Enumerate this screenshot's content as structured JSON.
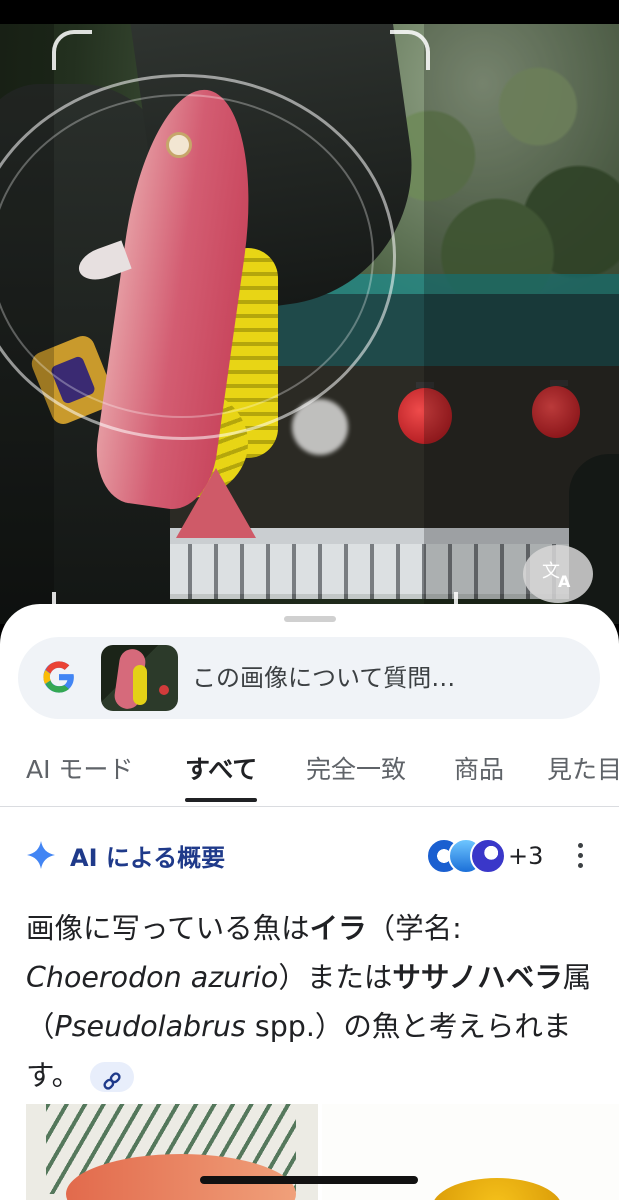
{
  "search": {
    "query_placeholder": "この画像について質問…"
  },
  "tabs": [
    {
      "label": "AI モード"
    },
    {
      "label": "すべて"
    },
    {
      "label": "完全一致"
    },
    {
      "label": "商品"
    },
    {
      "label": "見た目"
    }
  ],
  "ai_overview": {
    "title": "AI による概要",
    "sources_more": "+3",
    "answer": {
      "p1": "画像に写っている魚は",
      "fish1": "イラ",
      "p2": "（学名: ",
      "sci1": "Choerodon azurio",
      "p3": "）または",
      "fish2": "ササノハベラ",
      "p4": "属（",
      "sci2": "Pseudolabrus",
      "p5": " spp.）の魚と考えられます。"
    }
  },
  "colors": {
    "accent": "#1f3a8a",
    "sparkle": "#4285f4"
  },
  "icons": {
    "translate": "translate-icon",
    "google": "google-g-icon",
    "more": "more-vert-icon",
    "link": "link-icon"
  }
}
